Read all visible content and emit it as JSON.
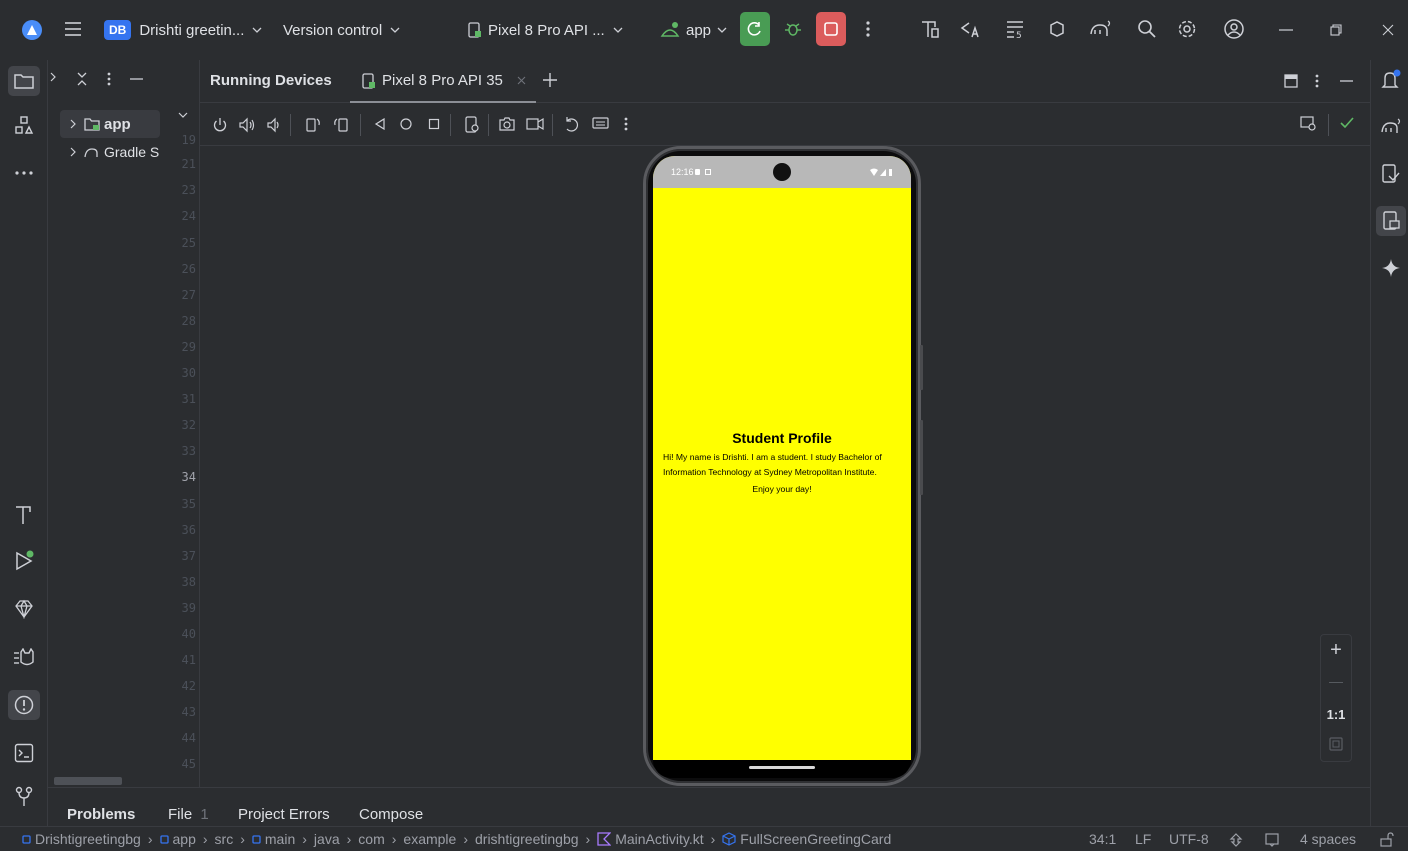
{
  "titlebar": {
    "project_badge": "DB",
    "project_name": "Drishti greetin...",
    "vcs": "Version control",
    "device": "Pixel 8 Pro API ...",
    "run_config": "app"
  },
  "colors": {
    "accent": "#3574f0",
    "run_green": "#499c54",
    "stop_red": "#db5c5c",
    "screen_bg": "#ffff00"
  },
  "project_tree": {
    "items": [
      {
        "label": "app",
        "icon": "folder-module-icon"
      },
      {
        "label": "Gradle S",
        "icon": "gradle-elephant-icon"
      }
    ]
  },
  "line_numbers": [
    "19",
    "21",
    "23",
    "24",
    "25",
    "26",
    "27",
    "28",
    "29",
    "30",
    "31",
    "32",
    "33",
    "34",
    "35",
    "36",
    "37",
    "38",
    "39",
    "40",
    "41",
    "42",
    "43",
    "44",
    "45"
  ],
  "running_devices": {
    "title": "Running Devices",
    "tab_label": "Pixel 8 Pro API 35"
  },
  "phone": {
    "status_time": "12:16",
    "heading": "Student Profile",
    "body": "Hi! My name is Drishti. I am a student. I study Bachelor of Information Technology at Sydney Metropolitan Institute.",
    "footer": "Enjoy your day!"
  },
  "zoom": {
    "plus": "+",
    "minus": "—",
    "one_to_one": "1:1"
  },
  "bottom_tabs": {
    "problems": "Problems",
    "file": "File",
    "file_count": "1",
    "project_errors": "Project Errors",
    "compose": "Compose"
  },
  "statusbar": {
    "breadcrumbs": [
      "Drishtigreetingbg",
      "app",
      "src",
      "main",
      "java",
      "com",
      "example",
      "drishtigreetingbg",
      "MainActivity.kt",
      "FullScreenGreetingCard"
    ],
    "position": "34:1",
    "line_sep": "LF",
    "encoding": "UTF-8",
    "indent": "4 spaces"
  }
}
